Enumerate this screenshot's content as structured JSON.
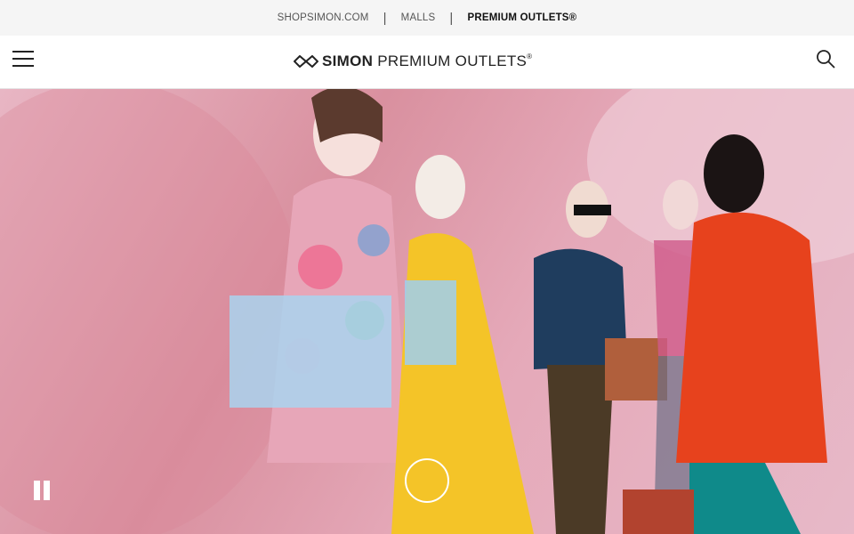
{
  "top_nav": {
    "links": [
      {
        "label": "SHOPSIMON.COM"
      },
      {
        "label": "MALLS"
      },
      {
        "label": "PREMIUM OUTLETS®"
      }
    ],
    "separator": "|"
  },
  "header": {
    "logo_brand": "SIMON",
    "logo_suffix": "PREMIUM OUTLETS",
    "logo_mark": "®"
  },
  "icons": {
    "menu": "hamburger-menu-icon",
    "search": "search-icon",
    "pause": "pause-icon",
    "play": "circle-play-icon"
  },
  "colors": {
    "top_bar_bg": "#f5f5f5",
    "hero_bg": "#dd9aaa",
    "text_dark": "#111111"
  }
}
